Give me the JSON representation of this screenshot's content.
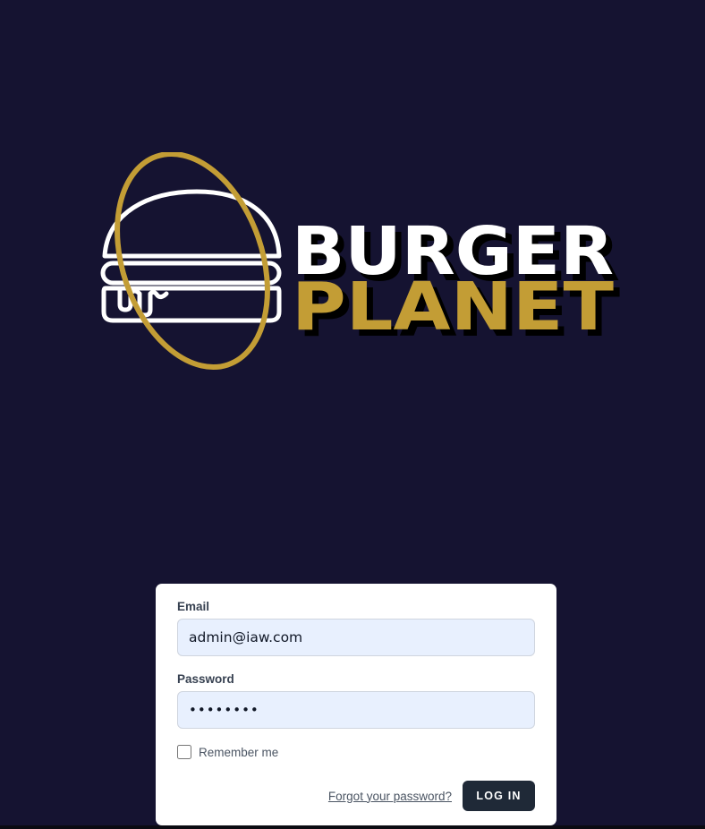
{
  "logo": {
    "line1": "BURGER",
    "line2": "PLANET",
    "colors": {
      "white": "#ffffff",
      "gold": "#c39d35",
      "shadow": "#000000",
      "background": "#151331"
    },
    "icon": "burger-planet-icon"
  },
  "login_form": {
    "email_label": "Email",
    "email_value": "admin@iaw.com",
    "password_label": "Password",
    "password_value": "••••••••",
    "remember_label": "Remember me",
    "forgot_link": "Forgot your password?",
    "submit_label": "LOG IN",
    "button_color": "#1f2937",
    "input_background": "#e8f0fe"
  }
}
